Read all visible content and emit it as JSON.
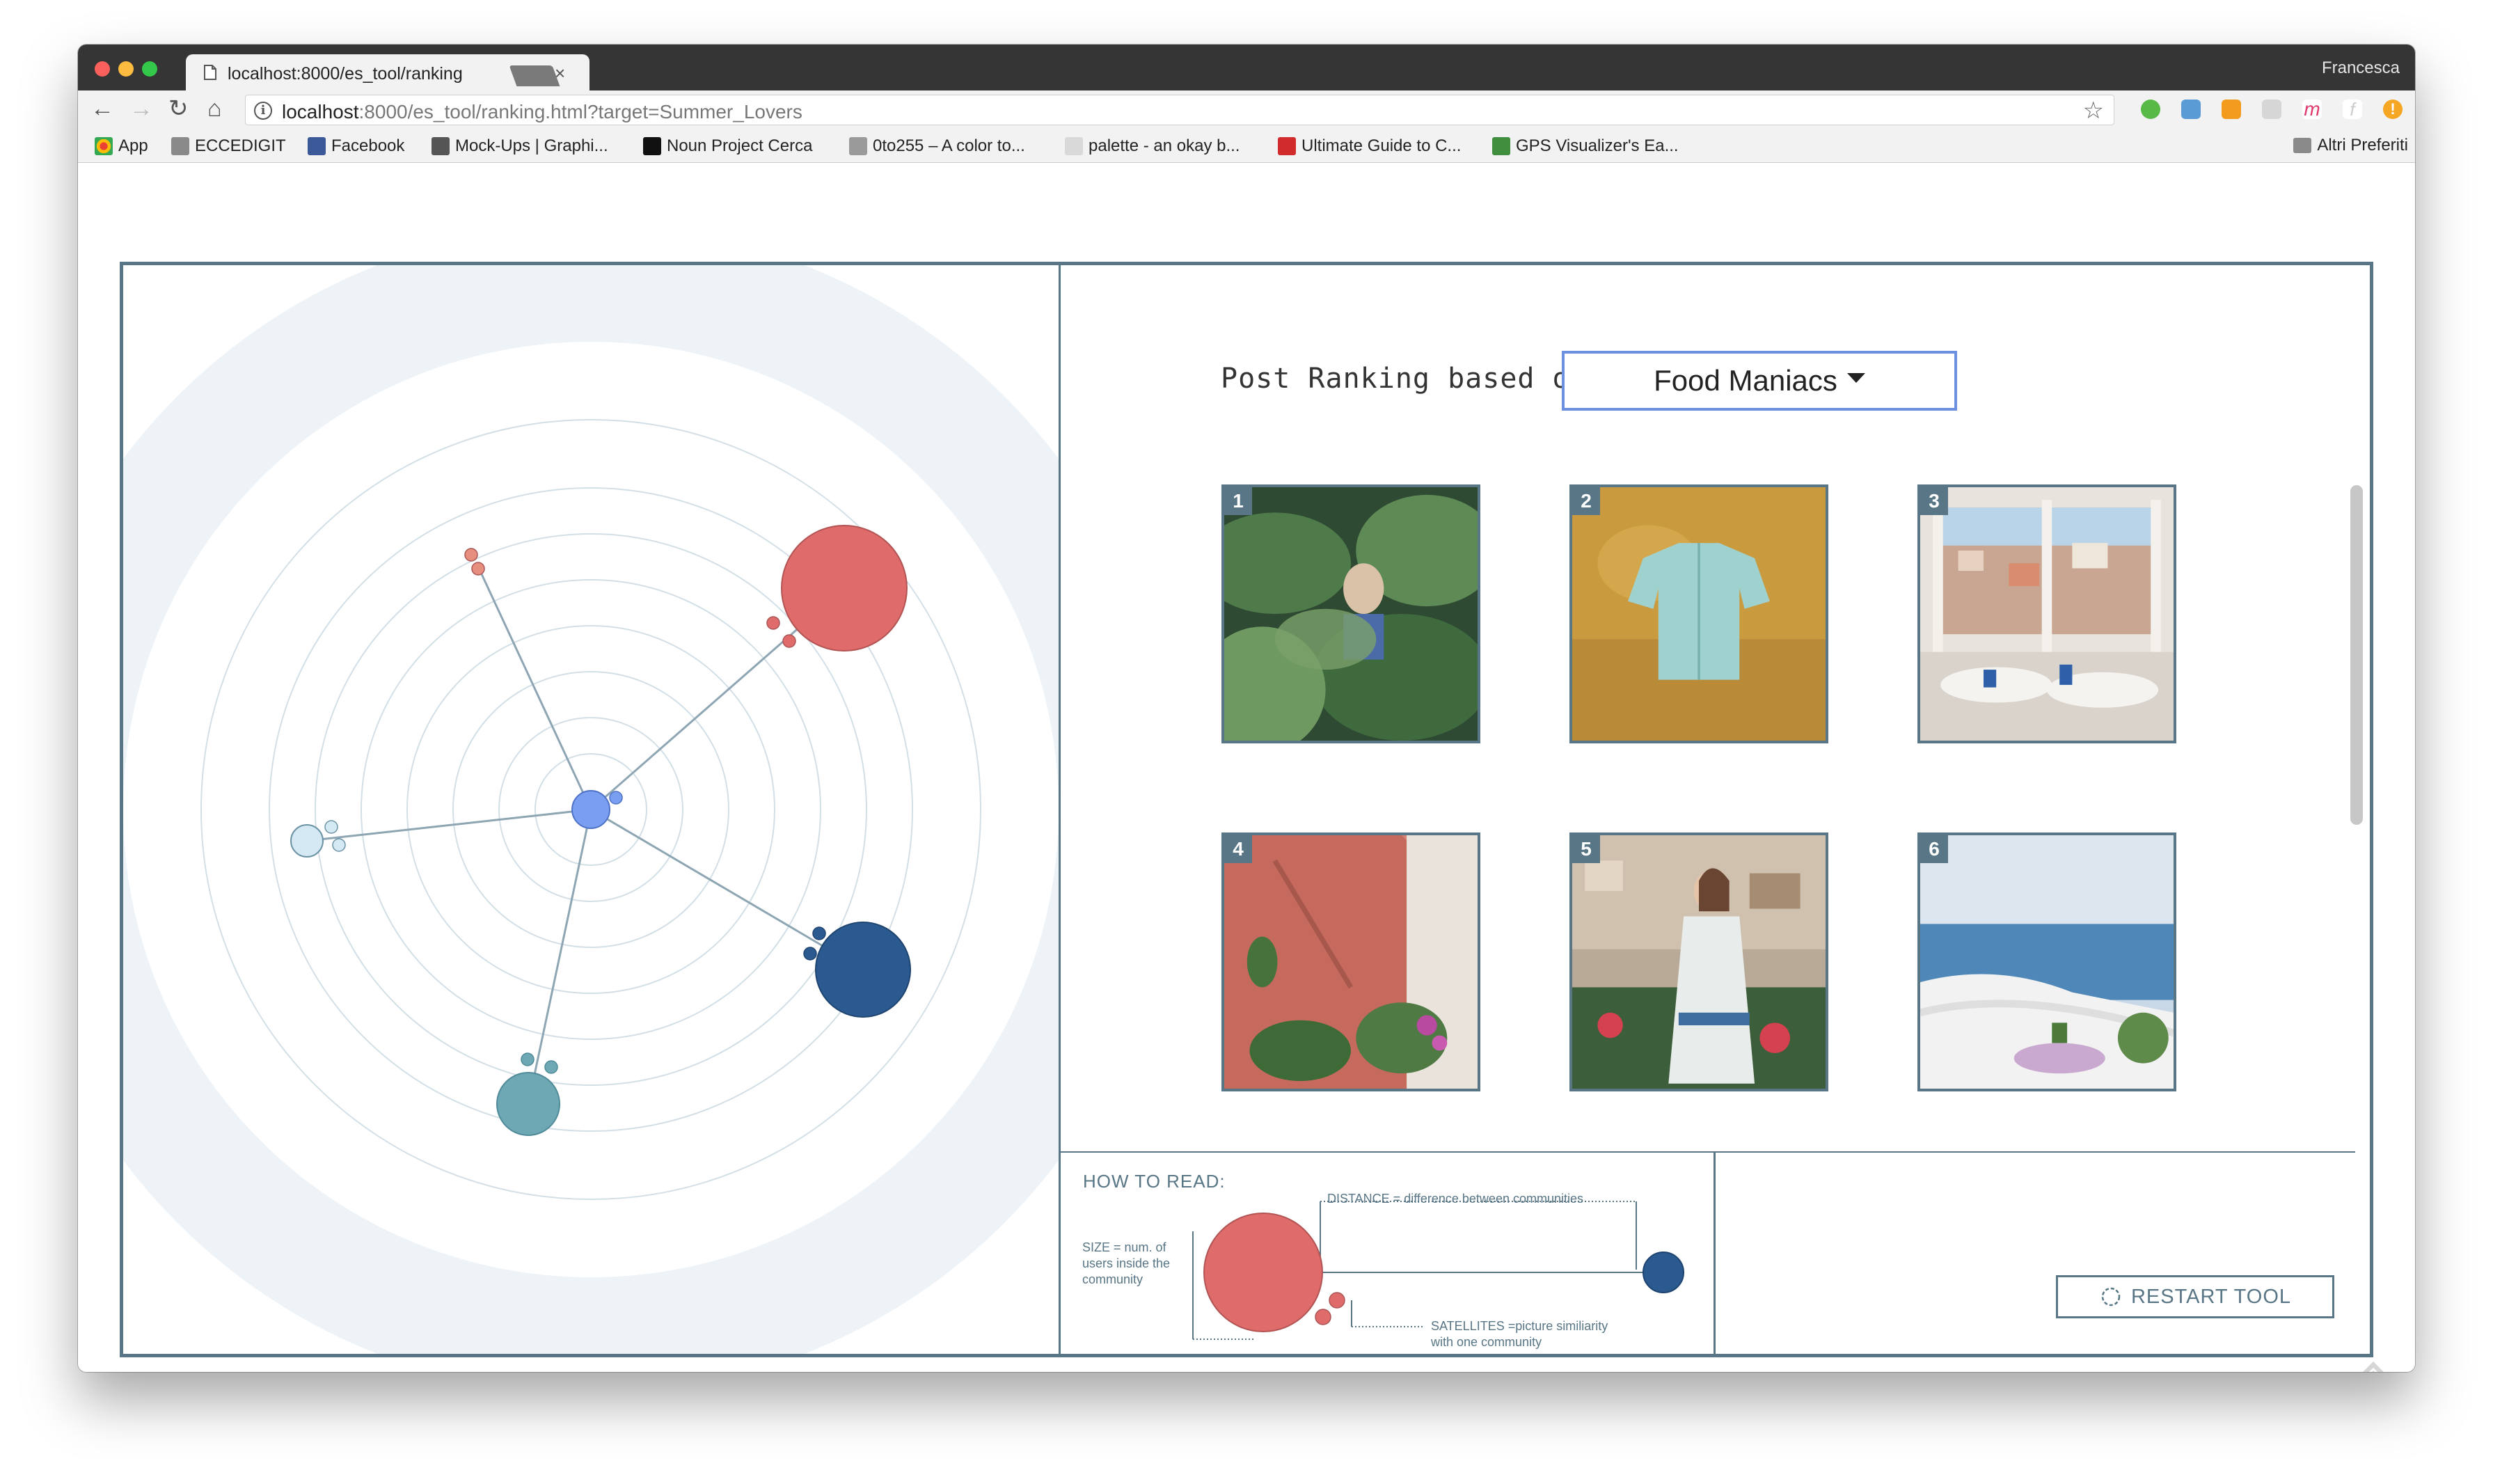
{
  "browser": {
    "tab_title": "localhost:8000/es_tool/ranking",
    "tab_close": "×",
    "profile_name": "Francesca",
    "url_host": "localhost",
    "url_rest": ":8000/es_tool/ranking.html?target=Summer_Lovers",
    "bookmarks": [
      {
        "label": "App",
        "icon": "apps-grid-icon",
        "color": "#e94235"
      },
      {
        "label": "ECCEDIGIT",
        "icon": "folder-icon",
        "color": "#8a8a8a"
      },
      {
        "label": "Facebook",
        "icon": "facebook-icon",
        "color": "#3b5998"
      },
      {
        "label": "Mock-Ups | Graphi...",
        "icon": "mockups-icon",
        "color": "#555555"
      },
      {
        "label": "Noun Project Cerca",
        "icon": "noun-project-icon",
        "color": "#111111"
      },
      {
        "label": "0to255 – A color to...",
        "icon": "0to255-icon",
        "color": "#9a9a9a"
      },
      {
        "label": "palette - an okay b...",
        "icon": "palette-icon",
        "color": "#d9d9d9"
      },
      {
        "label": "Ultimate Guide to C...",
        "icon": "guide-icon",
        "color": "#d12b2b"
      },
      {
        "label": "GPS Visualizer's Ea...",
        "icon": "gps-visualizer-icon",
        "color": "#3f8f3f"
      }
    ],
    "other_bookmarks": "Altri Preferiti"
  },
  "ranking": {
    "label": "Post Ranking based on",
    "selected_community": "Food Maniacs",
    "posts": [
      {
        "rank": "1",
        "scene": "tropical-leaves-portrait"
      },
      {
        "rank": "2",
        "scene": "shirt-on-ochre-wall"
      },
      {
        "rank": "3",
        "scene": "positano-terrace-restaurant"
      },
      {
        "rank": "4",
        "scene": "pink-wall-balcony"
      },
      {
        "rank": "5",
        "scene": "woman-dress-positano"
      },
      {
        "rank": "6",
        "scene": "sea-view-terrace"
      }
    ]
  },
  "legend": {
    "title": "HOW TO READ:",
    "distance": "DISTANCE = difference between communities",
    "size": [
      "SIZE = num. of",
      "users inside the",
      "community"
    ],
    "satellites": [
      "SATELLITES =picture similiarity",
      "with one community"
    ]
  },
  "restart_label": "RESTART TOOL",
  "colors": {
    "frame": "#587685",
    "food_maniacs": "#e06b6b",
    "navy_community": "#2a5a8f",
    "teal_community": "#6fa8b5",
    "light_community": "#d4e9f3",
    "center": "#7a9ef0",
    "select_border": "#6c8fe0"
  }
}
